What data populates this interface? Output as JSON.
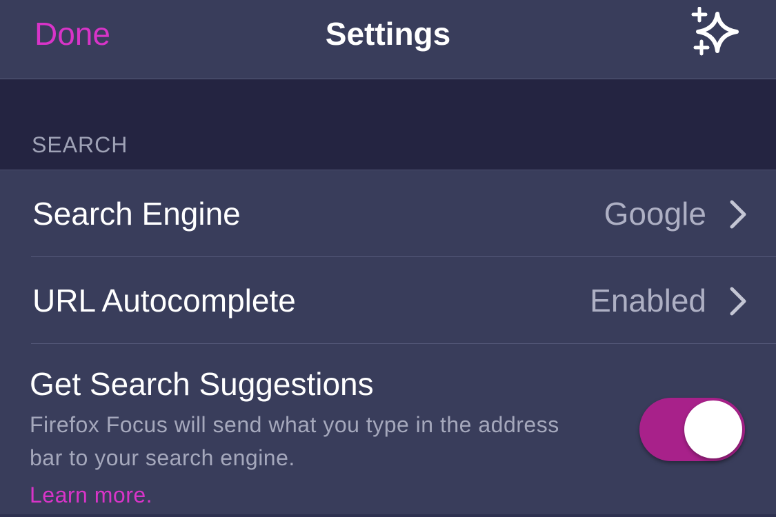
{
  "navbar": {
    "done_label": "Done",
    "title": "Settings",
    "whats_new_icon": "sparkle-icon"
  },
  "section": {
    "header": "SEARCH"
  },
  "rows": [
    {
      "label": "Search Engine",
      "value": "Google",
      "icon": "chevron-right-icon"
    },
    {
      "label": "URL Autocomplete",
      "value": "Enabled",
      "icon": "chevron-right-icon"
    }
  ],
  "suggestions": {
    "title": "Get Search Suggestions",
    "description": "Firefox Focus will send what you type in the address bar to your search engine.",
    "learn_more": "Learn more.",
    "toggle_on": true
  },
  "colors": {
    "accent": "#d834c8",
    "toggle_on": "#a8218a",
    "background": "#393d5b",
    "section_band": "#242441"
  }
}
